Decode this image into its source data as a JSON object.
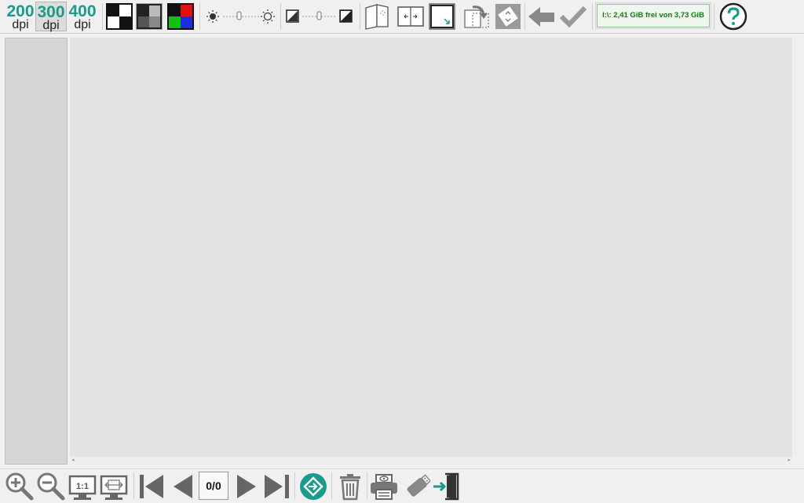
{
  "resolution": {
    "options": [
      {
        "value": "200",
        "unit": "dpi",
        "selected": false
      },
      {
        "value": "300",
        "unit": "dpi",
        "selected": true
      },
      {
        "value": "400",
        "unit": "dpi",
        "selected": false
      }
    ]
  },
  "color_modes": [
    {
      "icon": "black-white-mode-icon",
      "selected": false
    },
    {
      "icon": "grayscale-mode-icon",
      "selected": true
    },
    {
      "icon": "color-mode-icon",
      "selected": false
    }
  ],
  "sliders": [
    {
      "name": "brightness",
      "icon_left": "brightness-low-icon",
      "icon_right": "brightness-high-icon"
    },
    {
      "name": "contrast",
      "icon_left": "contrast-low-icon",
      "icon_right": "contrast-high-icon"
    }
  ],
  "tools": [
    {
      "icon": "duplex-pages-icon"
    },
    {
      "icon": "split-page-icon"
    },
    {
      "icon": "crop-icon"
    },
    {
      "icon": "rotate-page-icon"
    },
    {
      "icon": "auto-rotate-icon"
    },
    {
      "icon": "undo-arrow-icon"
    },
    {
      "icon": "checkmark-icon"
    }
  ],
  "status": {
    "storage_text": "I:\\: 2,41 GiB frei von 3,73 GiB",
    "color": "#137a13"
  },
  "help": {
    "icon": "help-icon",
    "color": "#1a9c8c"
  },
  "bottom_toolbar": {
    "zoom": [
      "zoom-in-icon",
      "zoom-out-icon",
      "zoom-actual-size-icon",
      "zoom-fit-width-icon"
    ],
    "navigation": [
      "first-page-icon",
      "previous-page-icon",
      "next-page-icon",
      "last-page-icon"
    ],
    "page_counter": "0/0",
    "actions": [
      "scan-start-icon",
      "trash-icon",
      "print-icon",
      "usb-export-icon",
      "exit-icon"
    ]
  },
  "accent_color": "#1a9c8c"
}
